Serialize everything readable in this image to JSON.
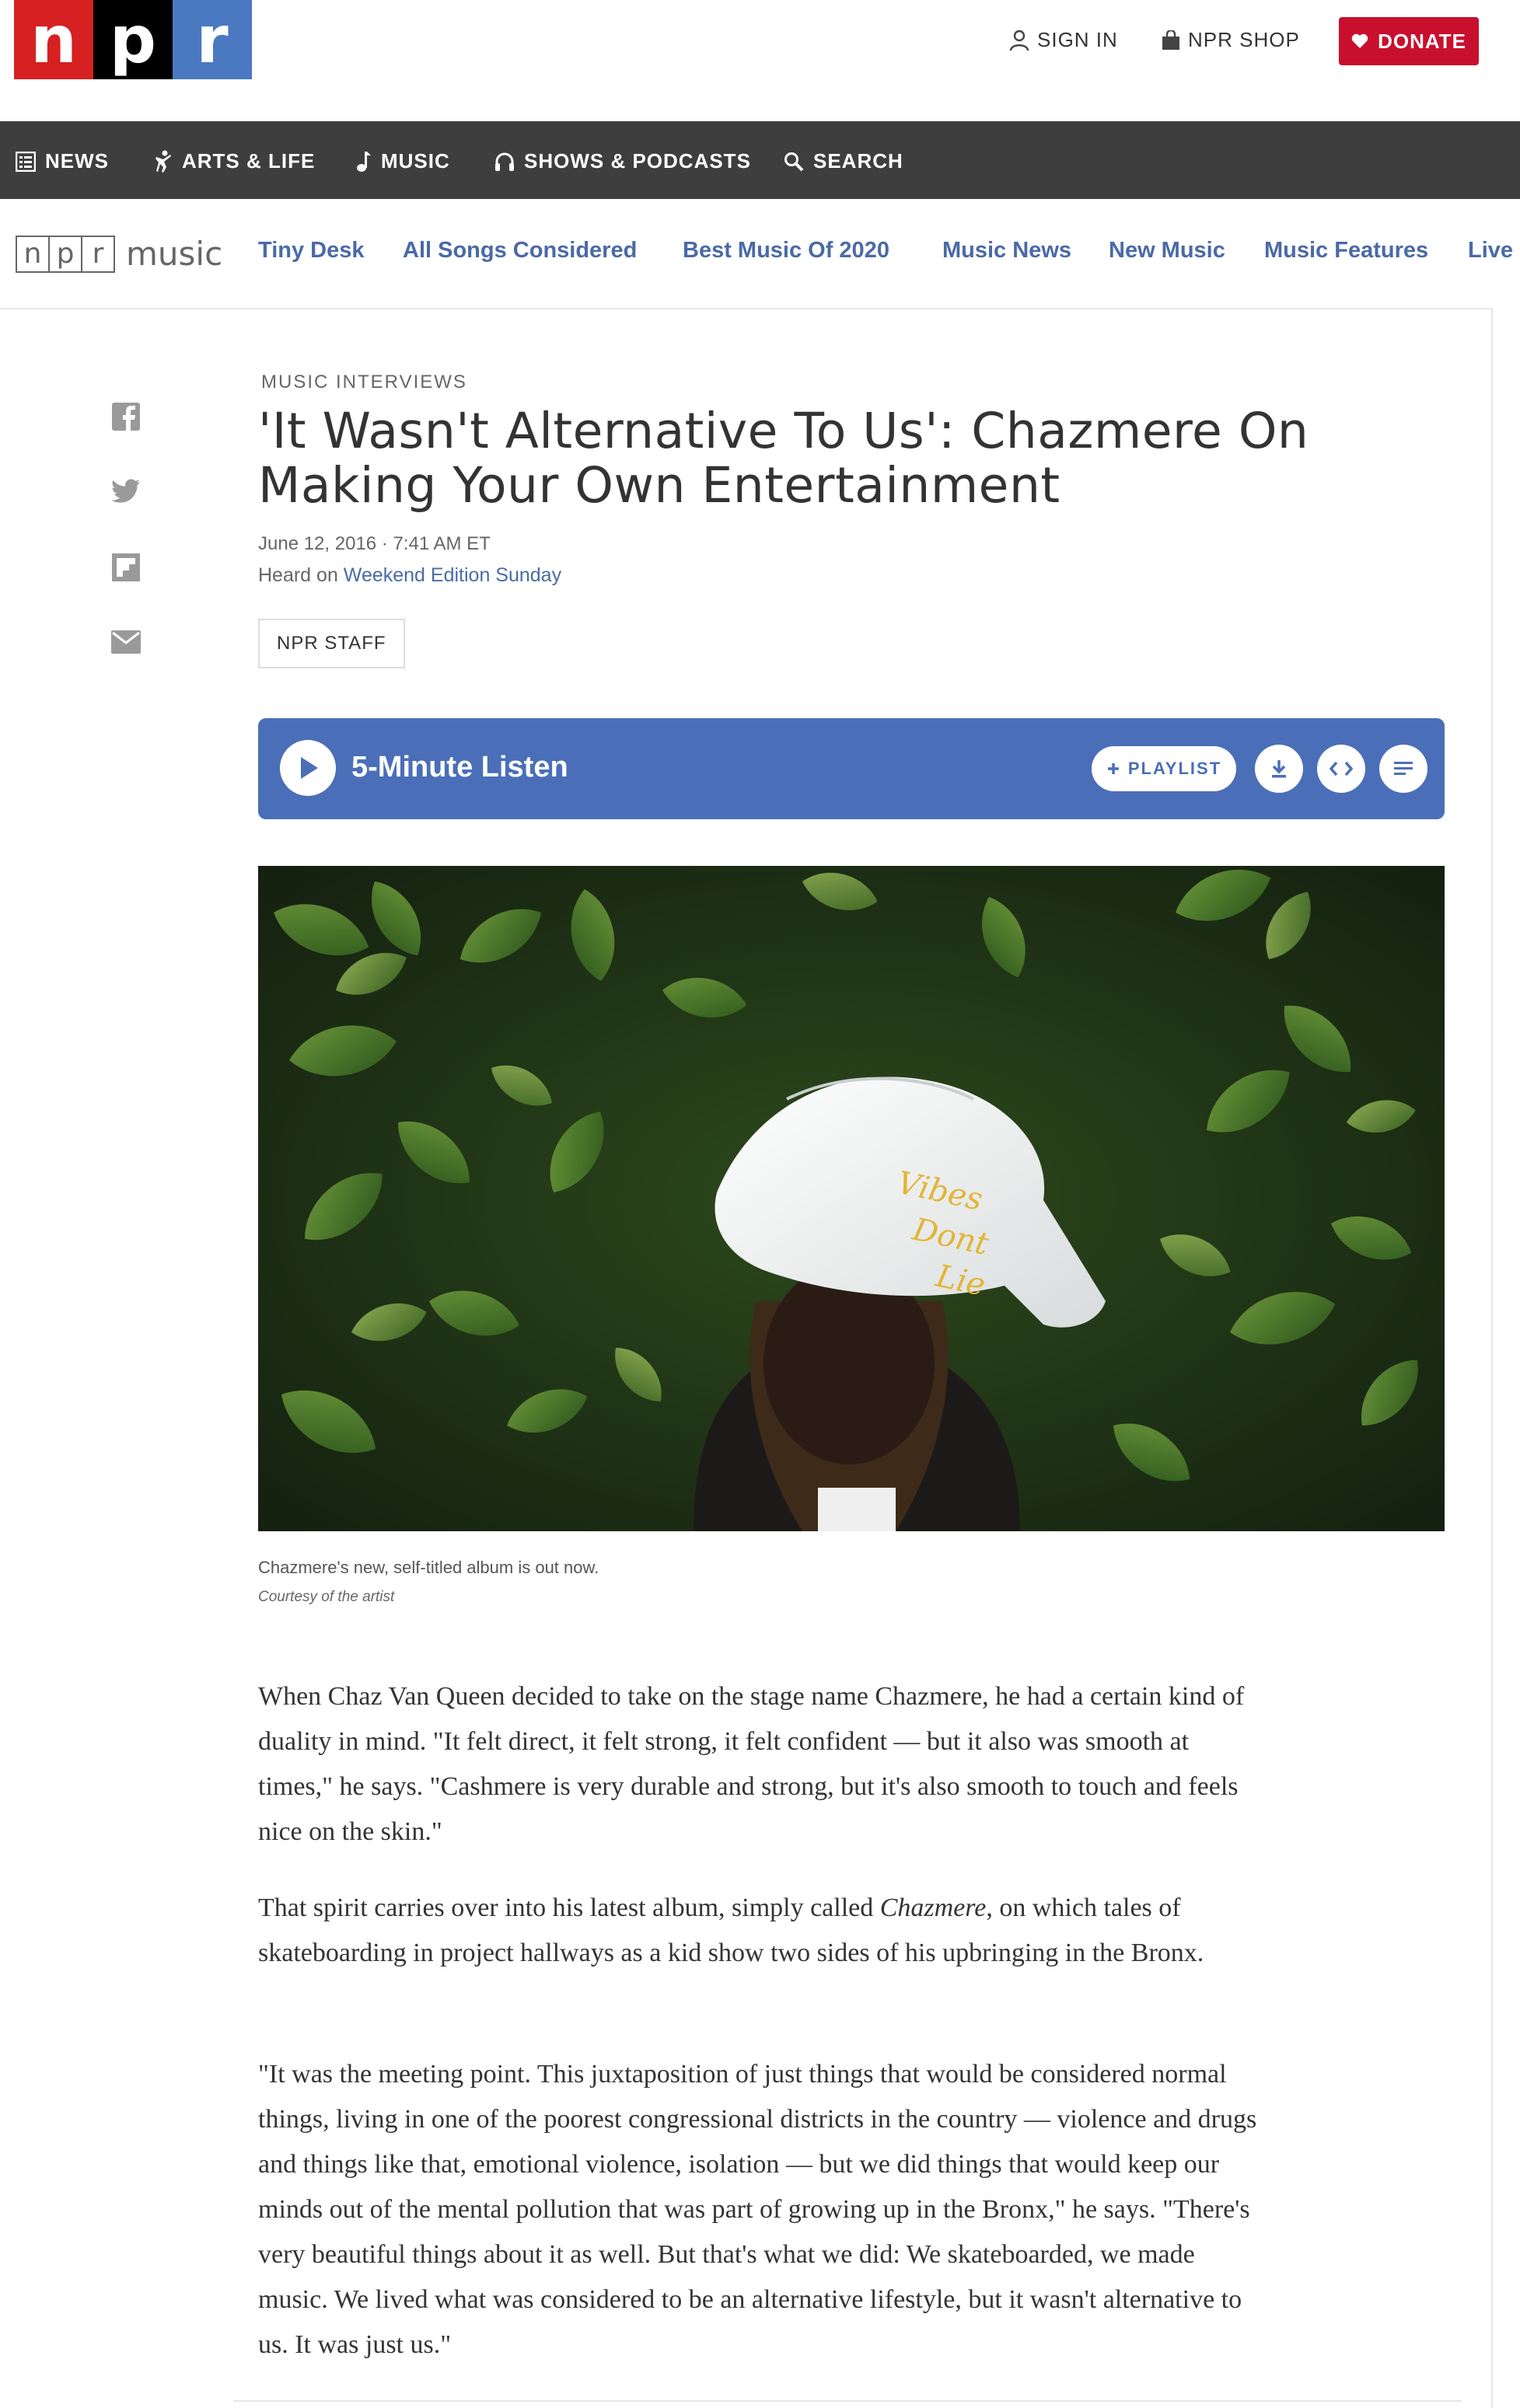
{
  "header": {
    "logo_letters": [
      "n",
      "p",
      "r"
    ],
    "sign_in": "SIGN IN",
    "shop": "NPR SHOP",
    "donate": "DONATE"
  },
  "main_nav": {
    "items": [
      {
        "label": "NEWS",
        "icon": "news-icon"
      },
      {
        "label": "ARTS & LIFE",
        "icon": "arts-icon"
      },
      {
        "label": "MUSIC",
        "icon": "music-note-icon"
      },
      {
        "label": "SHOWS & PODCASTS",
        "icon": "headphones-icon"
      },
      {
        "label": "SEARCH",
        "icon": "search-icon"
      }
    ]
  },
  "music_nav": {
    "logo_letters": [
      "n",
      "p",
      "r"
    ],
    "logo_word": "music",
    "links": [
      "Tiny Desk",
      "All Songs Considered",
      "Best Music Of 2020",
      "Music News",
      "New Music",
      "Music Features",
      "Live"
    ]
  },
  "article": {
    "slug": "MUSIC INTERVIEWS",
    "title": "'It Wasn't Alternative To Us': Chazmere On Making Your Own Entertainment",
    "date": "June 12, 2016 · 7:41 AM ET",
    "heard_prefix": "Heard on ",
    "heard_program": "Weekend Edition Sunday",
    "byline": "NPR STAFF",
    "share_icons": [
      "facebook-icon",
      "twitter-icon",
      "flipboard-icon",
      "email-icon"
    ]
  },
  "audio": {
    "label": "5-Minute Listen",
    "playlist": "PLAYLIST"
  },
  "image": {
    "caption": "Chazmere's new, self-titled album is out now.",
    "credit": "Courtesy of the artist",
    "hat_text": [
      "Vibes",
      "Dont",
      "Lie"
    ]
  },
  "body": {
    "p1": "When Chaz Van Queen decided to take on the stage name Chazmere, he had a certain kind of duality in mind. \"It felt direct, it felt strong, it felt confident — but it also was smooth at times,\" he says. \"Cashmere is very durable and strong, but it's also smooth to touch and feels nice on the skin.\"",
    "p2_before": "That spirit carries over into his latest album, simply called ",
    "p2_em": "Chazmere",
    "p2_after": ", on which tales of skateboarding in project hallways as a kid show two sides of his upbringing in the Bronx.",
    "p3": "\"It was the meeting point. This juxtaposition of just things that would be considered normal things, living in one of the poorest congressional districts in the country — violence and drugs and things like that, emotional violence, isolation — but we did things that would keep our minds out of the mental pollution that was part of growing up in the Bronx,\" he says. \"There's very beautiful things about it as well. But that's what we did: We skateboarded, we made music. We lived what was considered to be an alternative lifestyle, but it wasn't alternative to us. It was just us.\""
  },
  "colors": {
    "npr_red": "#d62021",
    "npr_blue": "#4a79c2",
    "donate_red": "#c8102e",
    "nav_dark": "#3e3e3e",
    "link_blue": "#4a6aa6",
    "audio_blue": "#4a6fb8"
  }
}
